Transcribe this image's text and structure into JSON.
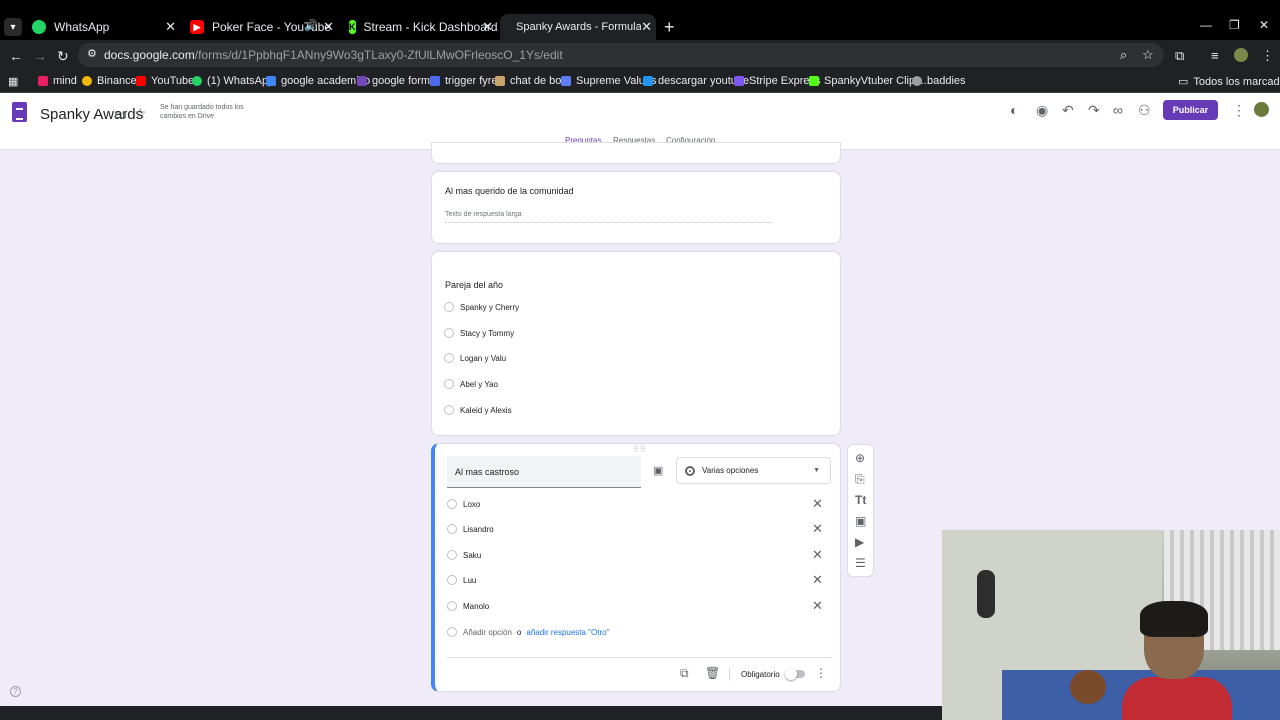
{
  "browser": {
    "tabs": [
      {
        "label": "WhatsApp",
        "icon": "whatsapp-icon",
        "color": "#25d366"
      },
      {
        "label": "Poker Face - YouTube",
        "icon": "youtube-icon",
        "color": "#ff0000"
      },
      {
        "label": "Stream - Kick Dashboard",
        "icon": "kick-icon",
        "color": "#53fc18"
      },
      {
        "label": "Spanky Awards - Formularios d",
        "icon": "forms-icon",
        "color": "#7248b9"
      }
    ],
    "url_host": "docs.google.com",
    "url_path": "/forms/d/1PpbhqF1ANny9Wo3gTLaxy0-ZfUlLMwOFrleoscO_1Ys/edit",
    "bookmarks": [
      {
        "label": "mind",
        "color": "#e91e63"
      },
      {
        "label": "Binance",
        "color": "#f0b90b"
      },
      {
        "label": "YouTube",
        "color": "#ff0000"
      },
      {
        "label": "(1) WhatsApp",
        "color": "#25d366"
      },
      {
        "label": "google academico",
        "color": "#4285f4"
      },
      {
        "label": "google forms",
        "color": "#7248b9"
      },
      {
        "label": "trigger fyre",
        "color": "#4f6bed"
      },
      {
        "label": "chat de bot",
        "color": "#c9a46b"
      },
      {
        "label": "Supreme Values",
        "color": "#5c7cfa"
      },
      {
        "label": "descargar youtube",
        "color": "#2196f3"
      },
      {
        "label": "Stripe Express",
        "color": "#7f57f1"
      },
      {
        "label": "SpankyVtuber Clips...",
        "color": "#53fc18"
      },
      {
        "label": "baddies",
        "color": "#9e9e9e"
      }
    ],
    "all_bookmarks": "Todos los marcadores"
  },
  "form": {
    "title": "Spanky Awards",
    "saved_status": "Se han guardado todos los cambios en Drive",
    "publish_label": "Publicar",
    "tabs": [
      "Preguntas",
      "Respuestas",
      "Configuración"
    ],
    "accent": "#673ab7"
  },
  "questions": {
    "q1": {
      "title": "Al mas querido de la comunidad",
      "placeholder": "Texto de respuesta larga"
    },
    "q2": {
      "title": "Pareja del año",
      "options": [
        "Spanky y Cherry",
        "Stacy y Tommy",
        "Logan y Valu",
        "Abel y Yao",
        "Kaleid y Alexis"
      ]
    },
    "q3": {
      "title": "Al mas castroso",
      "type": "Varias opciones",
      "options": [
        "Loxo",
        "Lisandro",
        "Saku",
        "Luu",
        "Manolo"
      ],
      "add_option": "Añadir opción",
      "or": "o",
      "add_other": "añadir respuesta \"Otro\"",
      "required_label": "Obligatorio"
    }
  }
}
